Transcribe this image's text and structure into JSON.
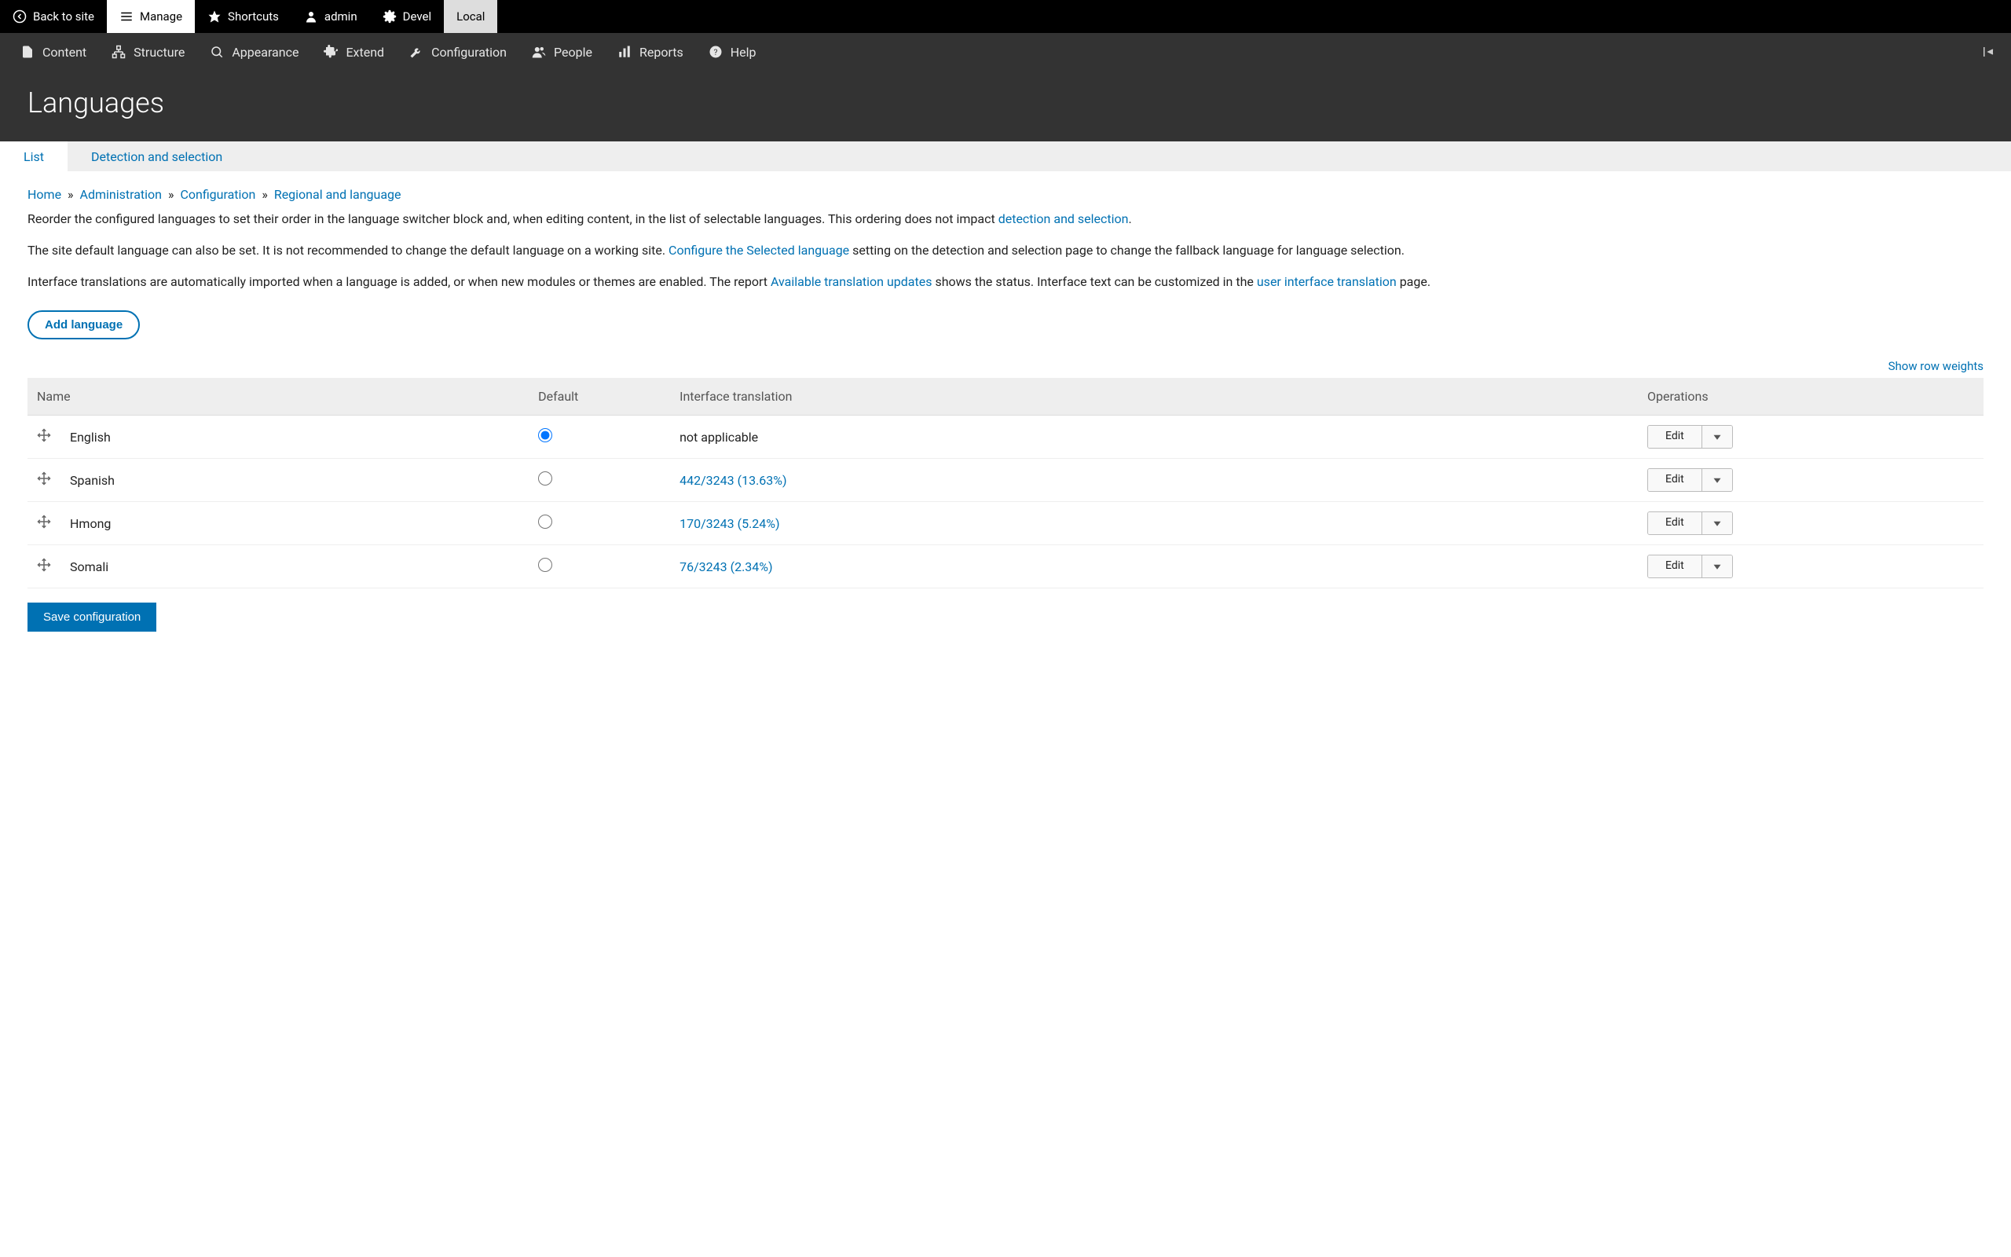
{
  "toolbar": {
    "back": "Back to site",
    "manage": "Manage",
    "shortcuts": "Shortcuts",
    "admin": "admin",
    "devel": "Devel",
    "local": "Local"
  },
  "adminbar": {
    "content": "Content",
    "structure": "Structure",
    "appearance": "Appearance",
    "extend": "Extend",
    "configuration": "Configuration",
    "people": "People",
    "reports": "Reports",
    "help": "Help"
  },
  "page_title": "Languages",
  "tabs": {
    "list": "List",
    "detection": "Detection and selection"
  },
  "breadcrumb": {
    "home": "Home",
    "admin": "Administration",
    "config": "Configuration",
    "regional": "Regional and language",
    "sep": "»"
  },
  "body": {
    "p1a": "Reorder the configured languages to set their order in the language switcher block and, when editing content, in the list of selectable languages. This ordering does not impact ",
    "p1link": "detection and selection",
    "p1b": ".",
    "p2a": "The site default language can also be set. It is not recommended to change the default language on a working site. ",
    "p2link": "Configure the Selected language",
    "p2b": " setting on the detection and selection page to change the fallback language for language selection.",
    "p3a": "Interface translations are automatically imported when a language is added, or when new modules or themes are enabled. The report ",
    "p3link1": "Available translation updates",
    "p3b": " shows the status. Interface text can be customized in the ",
    "p3link2": "user interface translation",
    "p3c": " page."
  },
  "add_language": "Add language",
  "show_weights": "Show row weights",
  "table": {
    "headers": {
      "name": "Name",
      "default": "Default",
      "translation": "Interface translation",
      "operations": "Operations"
    },
    "rows": [
      {
        "name": "English",
        "default": true,
        "translation": "not applicable",
        "translation_link": false
      },
      {
        "name": "Spanish",
        "default": false,
        "translation": "442/3243 (13.63%)",
        "translation_link": true
      },
      {
        "name": "Hmong",
        "default": false,
        "translation": "170/3243 (5.24%)",
        "translation_link": true
      },
      {
        "name": "Somali",
        "default": false,
        "translation": "76/3243 (2.34%)",
        "translation_link": true
      }
    ],
    "edit": "Edit"
  },
  "save": "Save configuration"
}
